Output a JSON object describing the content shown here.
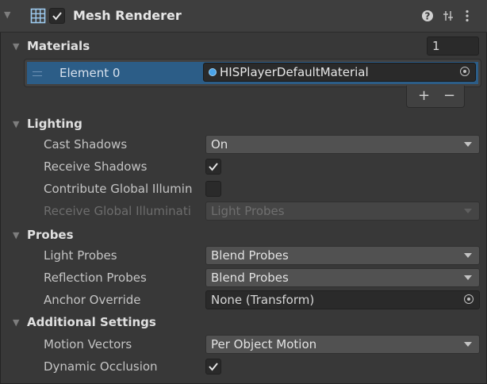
{
  "header": {
    "component_name": "Mesh Renderer",
    "enabled": true,
    "icons": [
      "mesh-renderer-icon",
      "help-icon",
      "presets-icon",
      "kebab-menu-icon"
    ]
  },
  "materials": {
    "title": "Materials",
    "count": "1",
    "elements": [
      {
        "label": "Element 0",
        "value": "HISPlayerDefaultMaterial"
      }
    ],
    "add_label": "+",
    "remove_label": "−"
  },
  "lighting": {
    "title": "Lighting",
    "cast_shadows": {
      "label": "Cast Shadows",
      "value": "On"
    },
    "receive_shadows": {
      "label": "Receive Shadows",
      "checked": true
    },
    "contribute_gi": {
      "label": "Contribute Global Illumin",
      "checked": false
    },
    "receive_gi": {
      "label": "Receive Global Illuminati",
      "value": "Light Probes"
    }
  },
  "probes": {
    "title": "Probes",
    "light_probes": {
      "label": "Light Probes",
      "value": "Blend Probes"
    },
    "reflection_probes": {
      "label": "Reflection Probes",
      "value": "Blend Probes"
    },
    "anchor_override": {
      "label": "Anchor Override",
      "value": "None (Transform)"
    }
  },
  "additional": {
    "title": "Additional Settings",
    "motion_vectors": {
      "label": "Motion Vectors",
      "value": "Per Object Motion"
    },
    "dynamic_occlusion": {
      "label": "Dynamic Occlusion",
      "checked": true
    }
  },
  "colors": {
    "background": "#383838",
    "header": "#3e3e3e",
    "selection": "#2c5d87",
    "checkbox_bg": "#2a2a2a",
    "dropdown_bg": "#515151"
  }
}
